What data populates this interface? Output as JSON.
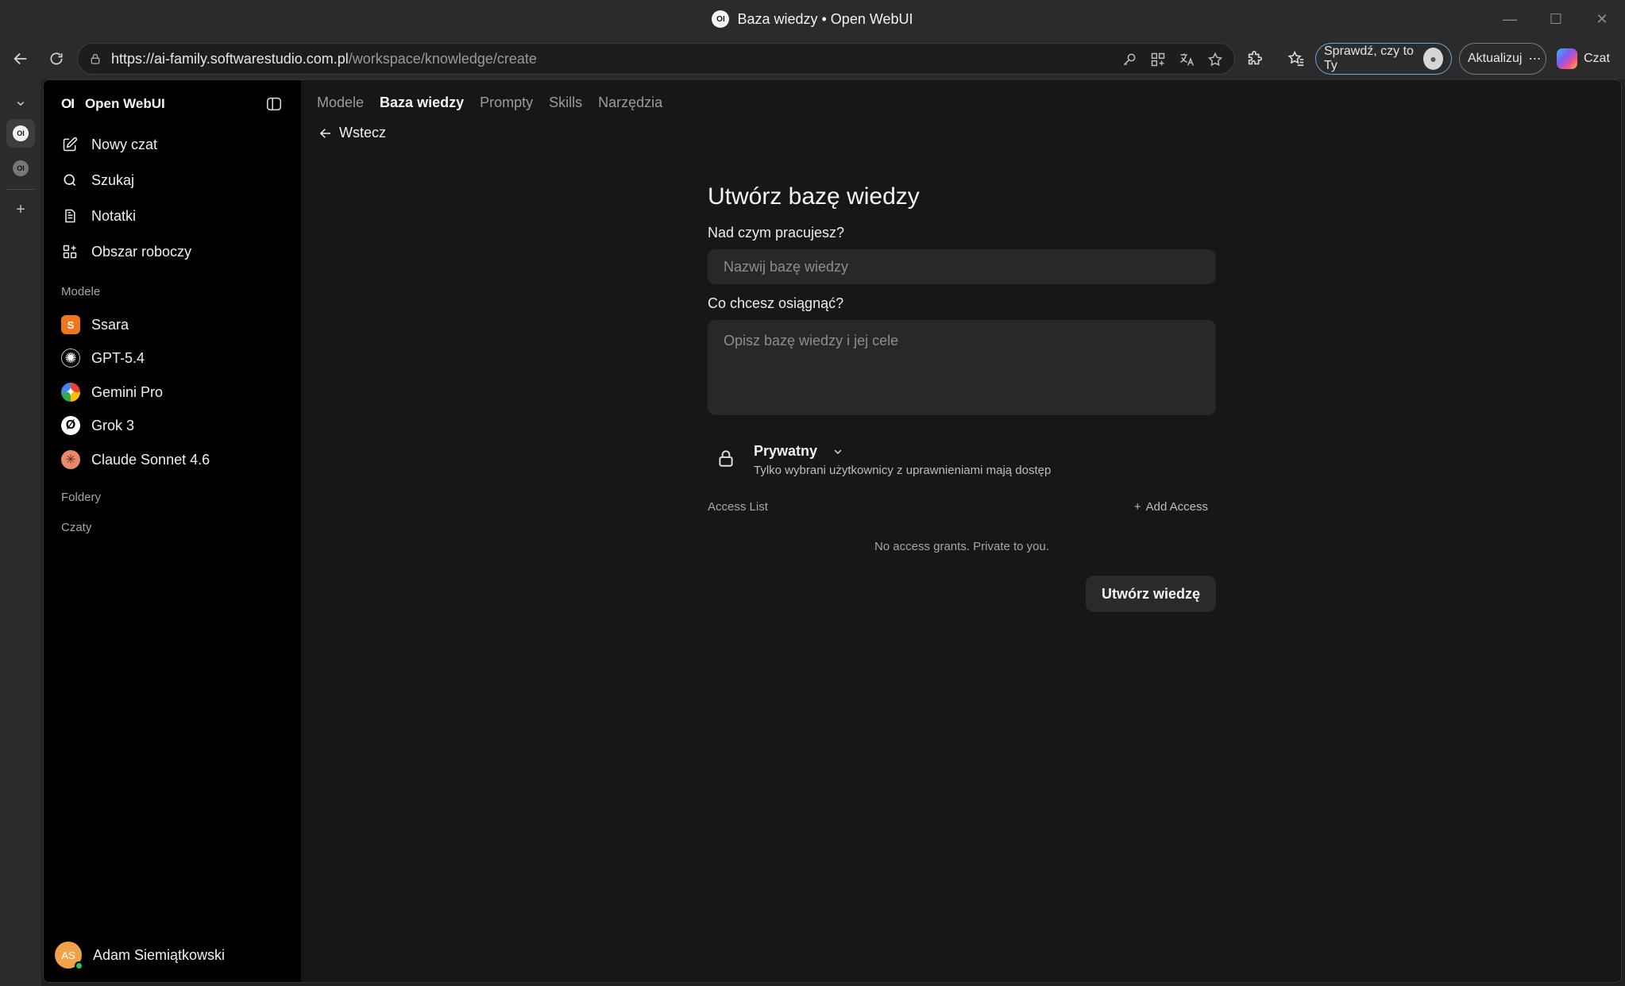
{
  "window": {
    "title": "Baza wiedzy • Open WebUI",
    "tab_logo": "OI"
  },
  "browser": {
    "url_host": "https://ai-family.softwarestudio.com.pl",
    "url_path": "/workspace/knowledge/create",
    "verify_label": "Sprawdź, czy to Ty",
    "update_label": "Aktualizuj",
    "copilot_label": "Czat"
  },
  "sidebar": {
    "brand": "Open WebUI",
    "brand_logo": "OI",
    "nav": [
      {
        "label": "Nowy czat",
        "icon": "pencil-square-icon"
      },
      {
        "label": "Szukaj",
        "icon": "search-icon"
      },
      {
        "label": "Notatki",
        "icon": "notes-icon"
      },
      {
        "label": "Obszar roboczy",
        "icon": "workspace-grid-icon"
      }
    ],
    "models_label": "Modele",
    "models": [
      {
        "label": "Ssara",
        "color": "#f2741f",
        "glyph": "S"
      },
      {
        "label": "GPT-5.4",
        "color": "#000000",
        "glyph": "✺"
      },
      {
        "label": "Gemini Pro",
        "color": "#4285f4",
        "glyph": "✦"
      },
      {
        "label": "Grok 3",
        "color": "#ffffff",
        "glyph": "Ø"
      },
      {
        "label": "Claude Sonnet 4.6",
        "color": "#e8896a",
        "glyph": "✳"
      }
    ],
    "folders_label": "Foldery",
    "chats_label": "Czaty",
    "user": {
      "name": "Adam Siemiątkowski",
      "initials": "AS"
    }
  },
  "main": {
    "tabs": [
      "Modele",
      "Baza wiedzy",
      "Prompty",
      "Skills",
      "Narzędzia"
    ],
    "active_tab": "Baza wiedzy",
    "back_label": "Wstecz",
    "form": {
      "title": "Utwórz bazę wiedzy",
      "name_label": "Nad czym pracujesz?",
      "name_placeholder": "Nazwij bazę wiedzy",
      "desc_label": "Co chcesz osiągnąć?",
      "desc_placeholder": "Opisz bazę wiedzy i jej cele",
      "visibility_title": "Prywatny",
      "visibility_desc": "Tylko wybrani użytkownicy z uprawnieniami mają dostęp",
      "access_list_label": "Access List",
      "add_access_label": "Add Access",
      "no_access_text": "No access grants. Private to you.",
      "submit_label": "Utwórz wiedzę"
    }
  }
}
